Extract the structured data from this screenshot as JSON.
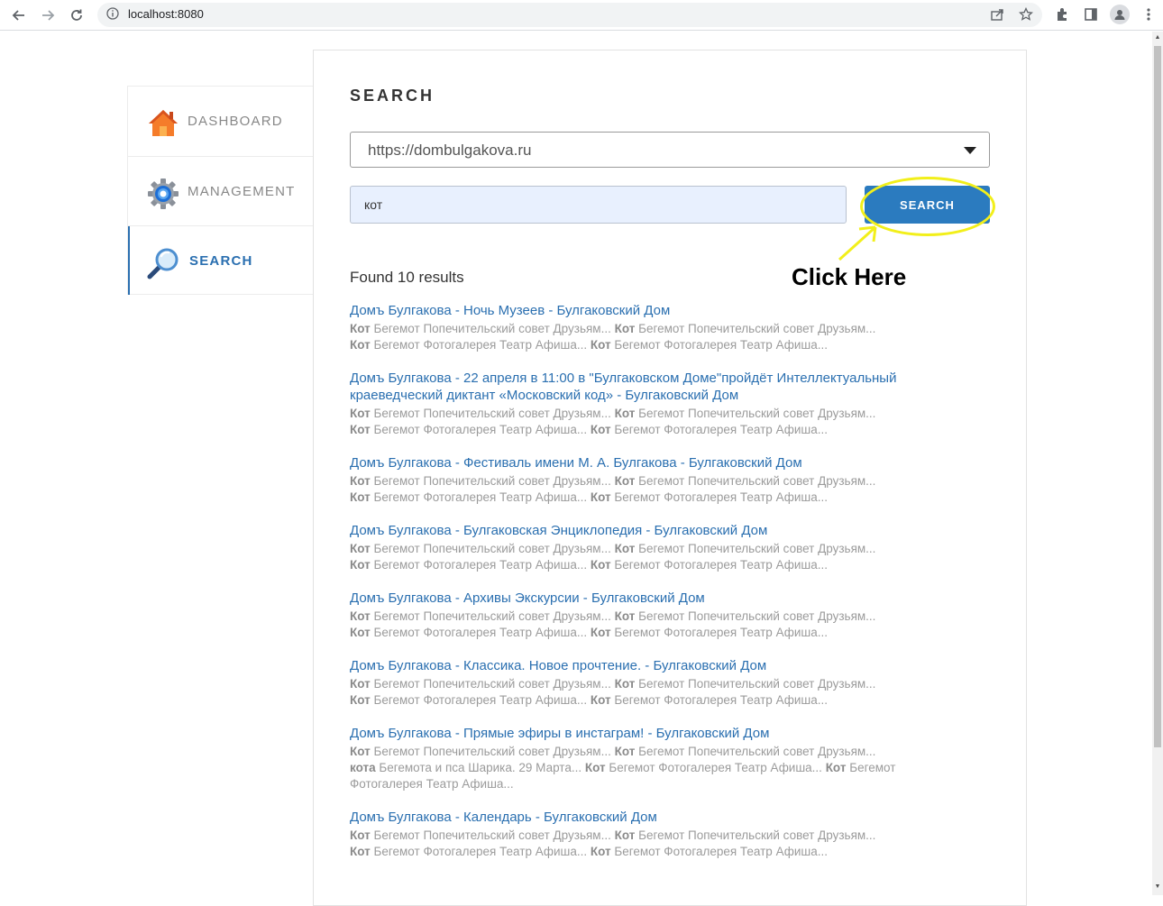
{
  "browser": {
    "url": "localhost:8080"
  },
  "sidebar": {
    "items": [
      {
        "label": "DASHBOARD",
        "icon": "home-icon",
        "active": false
      },
      {
        "label": "MANAGEMENT",
        "icon": "gear-icon",
        "active": false
      },
      {
        "label": "SEARCH",
        "icon": "magnifier-icon",
        "active": true
      }
    ]
  },
  "main": {
    "title": "SEARCH",
    "site_select_value": "https://dombulgakova.ru",
    "query_value": "кот",
    "search_button": "SEARCH",
    "callout": "Click Here",
    "found_text": "Found 10 results",
    "results": [
      {
        "title": "Домъ Булгакова - Ночь Музеев - Булгаковский Дом",
        "snippet_lines": [
          [
            [
              "Кот",
              true
            ],
            [
              " Бегемот Попечительский совет Друзьям... ",
              false
            ],
            [
              "Кот",
              true
            ],
            [
              " Бегемот Попечительский совет Друзьям...",
              false
            ]
          ],
          [
            [
              "Кот",
              true
            ],
            [
              " Бегемот Фотогалерея Театр Афиша... ",
              false
            ],
            [
              "Кот",
              true
            ],
            [
              " Бегемот Фотогалерея Театр Афиша...",
              false
            ]
          ]
        ]
      },
      {
        "title": "Домъ Булгакова - 22 апреля в 11:00 в \"Булгаковском Доме\"пройдёт Интеллектуальный краеведческий диктант «Московский код» - Булгаковский Дом",
        "snippet_lines": [
          [
            [
              "Кот",
              true
            ],
            [
              " Бегемот Попечительский совет Друзьям... ",
              false
            ],
            [
              "Кот",
              true
            ],
            [
              " Бегемот Попечительский совет Друзьям...",
              false
            ]
          ],
          [
            [
              "Кот",
              true
            ],
            [
              " Бегемот Фотогалерея Театр Афиша... ",
              false
            ],
            [
              "Кот",
              true
            ],
            [
              " Бегемот Фотогалерея Театр Афиша...",
              false
            ]
          ]
        ]
      },
      {
        "title": "Домъ Булгакова - Фестиваль имени М. А. Булгакова - Булгаковский Дом",
        "snippet_lines": [
          [
            [
              "Кот",
              true
            ],
            [
              " Бегемот Попечительский совет Друзьям... ",
              false
            ],
            [
              "Кот",
              true
            ],
            [
              " Бегемот Попечительский совет Друзьям...",
              false
            ]
          ],
          [
            [
              "Кот",
              true
            ],
            [
              " Бегемот Фотогалерея Театр Афиша... ",
              false
            ],
            [
              "Кот",
              true
            ],
            [
              " Бегемот Фотогалерея Театр Афиша...",
              false
            ]
          ]
        ]
      },
      {
        "title": "Домъ Булгакова - Булгаковская Энциклопедия - Булгаковский Дом",
        "snippet_lines": [
          [
            [
              "Кот",
              true
            ],
            [
              " Бегемот Попечительский совет Друзьям... ",
              false
            ],
            [
              "Кот",
              true
            ],
            [
              " Бегемот Попечительский совет Друзьям...",
              false
            ]
          ],
          [
            [
              "Кот",
              true
            ],
            [
              " Бегемот Фотогалерея Театр Афиша... ",
              false
            ],
            [
              "Кот",
              true
            ],
            [
              " Бегемот Фотогалерея Театр Афиша...",
              false
            ]
          ]
        ]
      },
      {
        "title": "Домъ Булгакова - Архивы Экскурсии - Булгаковский Дом",
        "snippet_lines": [
          [
            [
              "Кот",
              true
            ],
            [
              " Бегемот Попечительский совет Друзьям... ",
              false
            ],
            [
              "Кот",
              true
            ],
            [
              " Бегемот Попечительский совет Друзьям...",
              false
            ]
          ],
          [
            [
              "Кот",
              true
            ],
            [
              " Бегемот Фотогалерея Театр Афиша... ",
              false
            ],
            [
              "Кот",
              true
            ],
            [
              " Бегемот Фотогалерея Театр Афиша...",
              false
            ]
          ]
        ]
      },
      {
        "title": "Домъ Булгакова - Классика. Новое прочтение. - Булгаковский Дом",
        "snippet_lines": [
          [
            [
              "Кот",
              true
            ],
            [
              " Бегемот Попечительский совет Друзьям... ",
              false
            ],
            [
              "Кот",
              true
            ],
            [
              " Бегемот Попечительский совет Друзьям...",
              false
            ]
          ],
          [
            [
              "Кот",
              true
            ],
            [
              " Бегемот Фотогалерея Театр Афиша... ",
              false
            ],
            [
              "Кот",
              true
            ],
            [
              " Бегемот Фотогалерея Театр Афиша...",
              false
            ]
          ]
        ]
      },
      {
        "title": "Домъ Булгакова - Прямые эфиры в инстаграм! - Булгаковский Дом",
        "snippet_lines": [
          [
            [
              "Кот",
              true
            ],
            [
              " Бегемот Попечительский совет Друзьям... ",
              false
            ],
            [
              "Кот",
              true
            ],
            [
              " Бегемот Попечительский совет Друзьям...",
              false
            ]
          ],
          [
            [
              "кота",
              true
            ],
            [
              " Бегемота и пса Шарика. 29 Марта... ",
              false
            ],
            [
              "Кот",
              true
            ],
            [
              " Бегемот Фотогалерея Театр Афиша... ",
              false
            ],
            [
              "Кот",
              true
            ],
            [
              " Бегемот",
              false
            ]
          ],
          [
            [
              "Фотогалерея Театр Афиша...",
              false
            ]
          ]
        ]
      },
      {
        "title": "Домъ Булгакова - Календарь - Булгаковский Дом",
        "snippet_lines": [
          [
            [
              "Кот",
              true
            ],
            [
              " Бегемот Попечительский совет Друзьям... ",
              false
            ],
            [
              "Кот",
              true
            ],
            [
              " Бегемот Попечительский совет Друзьям...",
              false
            ]
          ],
          [
            [
              "Кот",
              true
            ],
            [
              " Бегемот Фотогалерея Театр Афиша... ",
              false
            ],
            [
              "Кот",
              true
            ],
            [
              " Бегемот Фотогалерея Театр Афиша...",
              false
            ]
          ]
        ]
      }
    ]
  },
  "colors": {
    "accent": "#2a6fb0",
    "button": "#2b7bbf",
    "highlight": "#f2ef1a",
    "snippet": "#9b9b9b"
  }
}
